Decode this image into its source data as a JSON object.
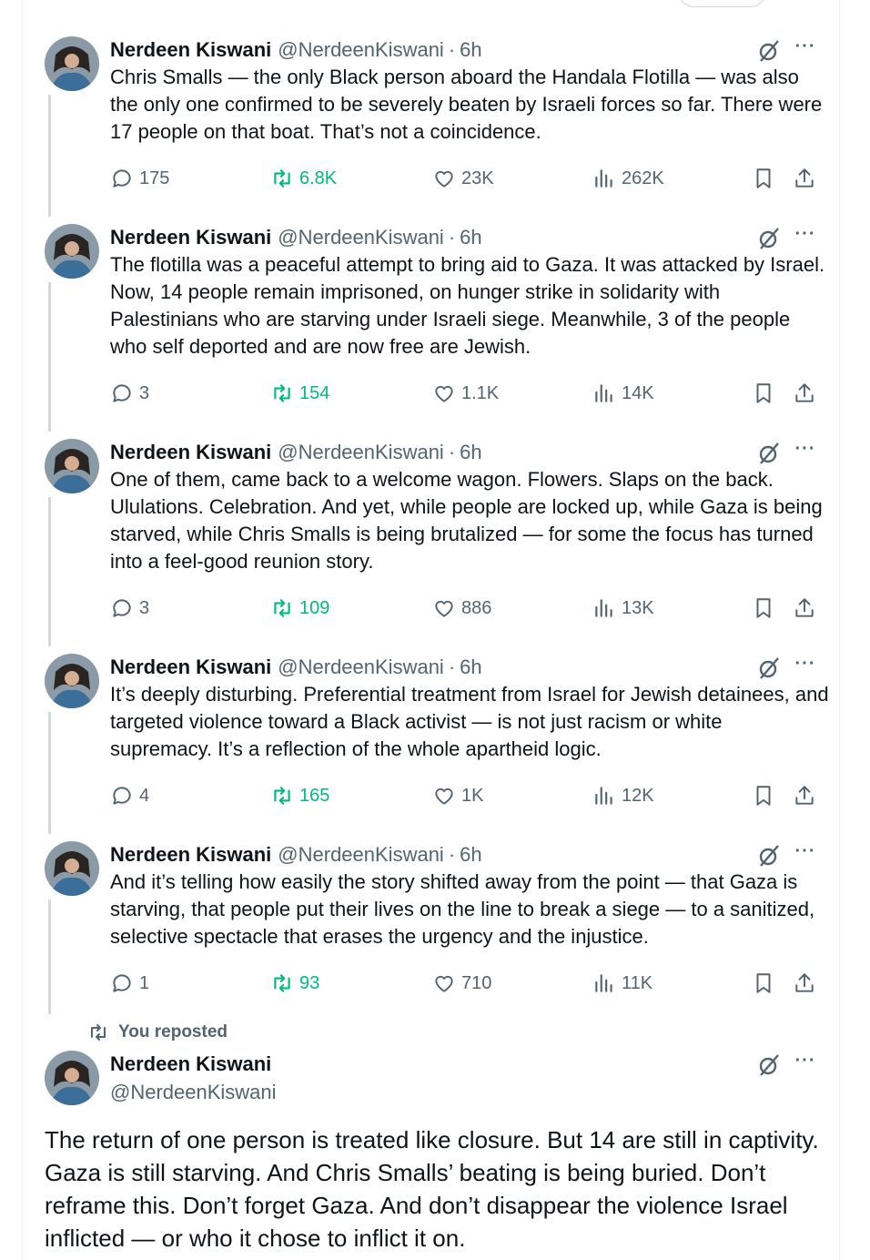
{
  "author": {
    "name": "Nerdeen Kiswani",
    "handle": "@NerdeenKiswani"
  },
  "separator": "·",
  "more_label": "···",
  "thread": [
    {
      "time": "6h",
      "text": "Chris Smalls — the only Black person aboard the Handala Flotilla — was also the only one confirmed to be severely beaten by Israeli forces so far. There were 17 people on that boat. That’s not a coincidence.",
      "replies": "175",
      "reposts": "6.8K",
      "likes": "23K",
      "views": "262K"
    },
    {
      "time": "6h",
      "text": "The flotilla was a peaceful attempt to bring aid to Gaza. It was attacked by Israel. Now, 14 people remain imprisoned, on hunger strike in solidarity with Palestinians who are starving under Israeli siege. Meanwhile, 3 of the people who self deported and are now free are Jewish.",
      "replies": "3",
      "reposts": "154",
      "likes": "1.1K",
      "views": "14K"
    },
    {
      "time": "6h",
      "text": "One of them, came back to a welcome wagon. Flowers. Slaps on the back. Ululations. Celebration. And yet, while people are locked up, while Gaza is being starved, while Chris Smalls is being brutalized — for some the focus has turned into a feel-good reunion story.",
      "replies": "3",
      "reposts": "109",
      "likes": "886",
      "views": "13K"
    },
    {
      "time": "6h",
      "text": "It’s deeply disturbing. Preferential treatment from Israel for Jewish detainees, and targeted violence toward a Black activist — is not just racism or white supremacy. It’s a reflection of the whole apartheid logic.",
      "replies": "4",
      "reposts": "165",
      "likes": "1K",
      "views": "12K"
    },
    {
      "time": "6h",
      "text": "And it’s telling how easily the story shifted away from the point — that Gaza is starving, that people put their lives on the line to break a siege — to a sanitized, selective spectacle that erases the urgency and the injustice.",
      "replies": "1",
      "reposts": "93",
      "likes": "710",
      "views": "11K"
    }
  ],
  "repost_note": "You reposted",
  "main_post": {
    "text": "The return of one person is treated like closure. But 14 are still in captivity. Gaza is still starving. And Chris Smalls’ beating is being buried. Don’t reframe this. Don’t forget Gaza. And don’t disappear the violence Israel inflicted — or who it chose to inflict it on."
  },
  "colors": {
    "text": "#0f1419",
    "secondary": "#536471",
    "repost_green": "#00ba7c",
    "thread_line": "#cfd9de"
  },
  "icons": [
    "reply-icon",
    "repost-icon",
    "like-icon",
    "views-icon",
    "bookmark-icon",
    "share-icon",
    "grok-icon",
    "more-icon"
  ]
}
